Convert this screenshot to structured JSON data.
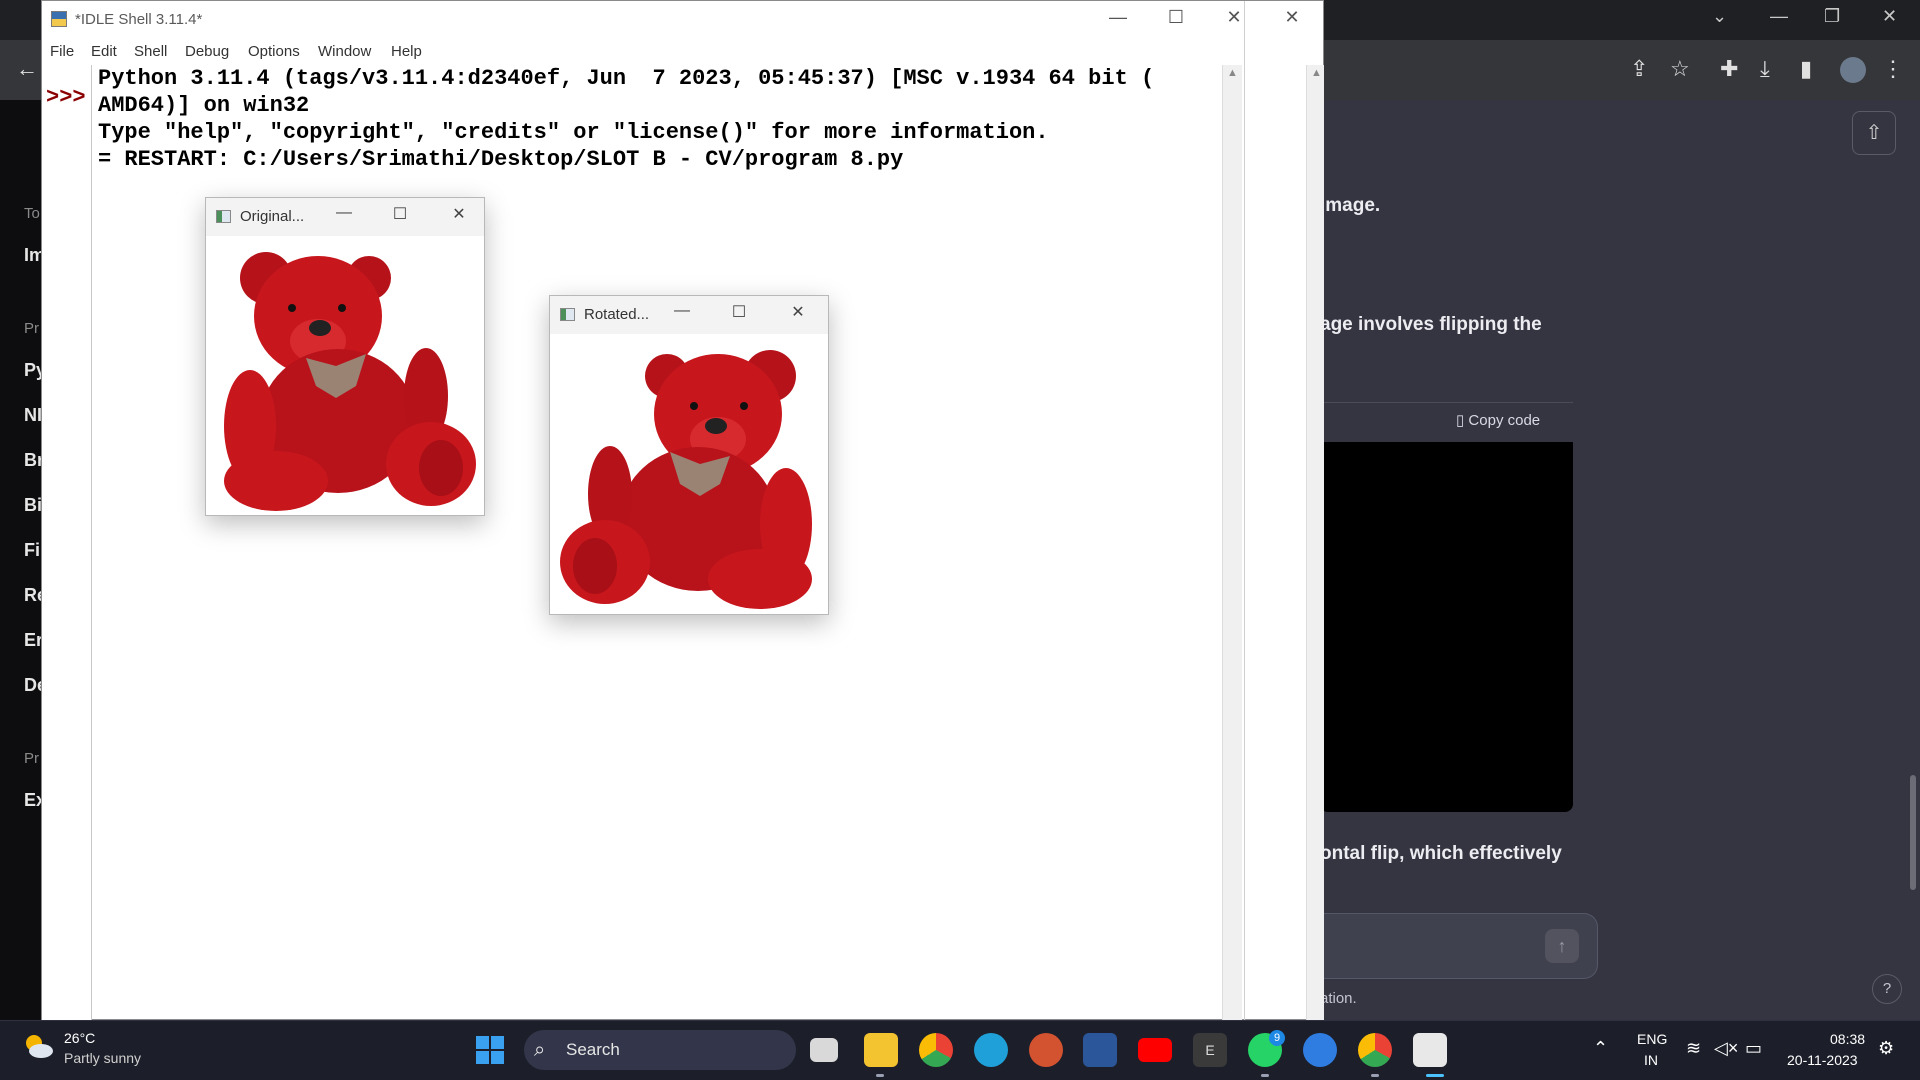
{
  "idle": {
    "title": "*IDLE Shell 3.11.4*",
    "menu": [
      "File",
      "Edit",
      "Shell",
      "Debug",
      "Options",
      "Window",
      "Help"
    ],
    "prompt": ">>>",
    "lines": [
      "Python 3.11.4 (tags/v3.11.4:d2340ef, Jun  7 2023, 05:45:37) [MSC v.1934 64 bit (",
      "AMD64)] on win32",
      "Type \"help\", \"copyright\", \"credits\" or \"license()\" for more information.",
      "",
      "= RESTART: C:/Users/Srimathi/Desktop/SLOT B - CV/program 8.py"
    ]
  },
  "windows": {
    "original": {
      "title": "Original..."
    },
    "rotated": {
      "title": "Rotated..."
    }
  },
  "chrome_bg": {
    "sidebar_partial": [
      "To",
      "Im",
      "Pr",
      "Py",
      "NI",
      "Br",
      "Bi",
      "Fi",
      "Re",
      "Er",
      "De",
      "Pr",
      "Ex"
    ],
    "chat_fragments": [
      "image.",
      "age involves flipping the",
      "ontal flip, which effectively",
      "ation."
    ],
    "copy_code": "Copy code"
  },
  "taskbar": {
    "weather_temp": "26°C",
    "weather_desc": "Partly sunny",
    "search_label": "Search",
    "lang_line1": "ENG",
    "lang_line2": "IN",
    "time": "08:38",
    "date": "20-11-2023",
    "whatsapp_badge": "9"
  },
  "colors": {
    "bear_red": "#c8161d",
    "prompt_red": "#8b0000",
    "taskbar_bg": "#1c1f2a"
  }
}
